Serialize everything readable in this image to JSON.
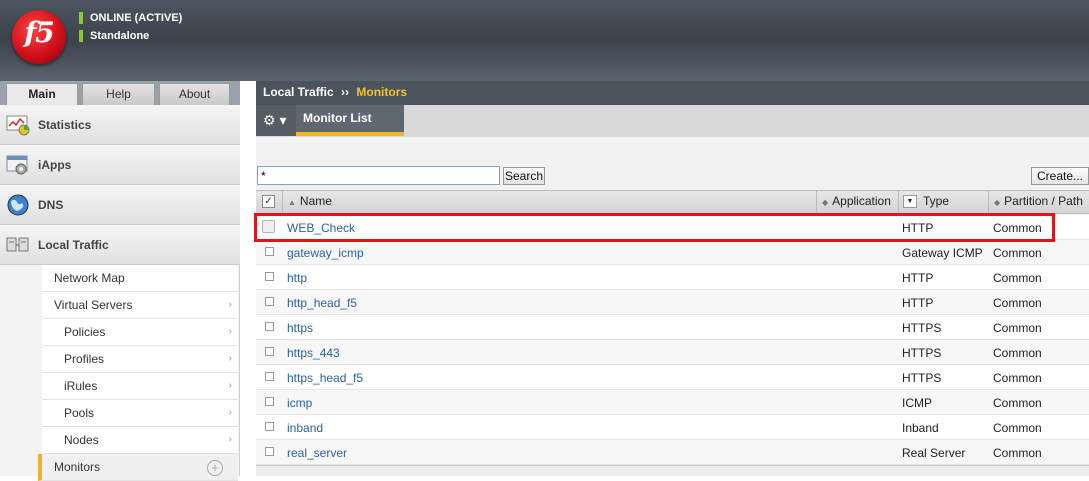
{
  "header": {
    "logo_text": "f5",
    "status_line1": "ONLINE (ACTIVE)",
    "status_line2": "Standalone",
    "status_color": "#8bc53f"
  },
  "tabs": [
    {
      "label": "Main",
      "active": true
    },
    {
      "label": "Help",
      "active": false
    },
    {
      "label": "About",
      "active": false
    }
  ],
  "nav": {
    "sections": [
      {
        "label": "Statistics",
        "icon": "statistics-chart-icon"
      },
      {
        "label": "iApps",
        "icon": "iapps-gear-icon"
      },
      {
        "label": "DNS",
        "icon": "globe-icon"
      },
      {
        "label": "Local Traffic",
        "icon": "local-traffic-icon"
      }
    ],
    "sub_items": [
      {
        "label": "Network Map",
        "indent": 0,
        "chevron": false
      },
      {
        "label": "Virtual Servers",
        "indent": 0,
        "chevron": true
      },
      {
        "label": "Policies",
        "indent": 1,
        "chevron": true
      },
      {
        "label": "Profiles",
        "indent": 1,
        "chevron": true
      },
      {
        "label": "iRules",
        "indent": 1,
        "chevron": true
      },
      {
        "label": "Pools",
        "indent": 1,
        "chevron": true
      },
      {
        "label": "Nodes",
        "indent": 1,
        "chevron": true
      },
      {
        "label": "Monitors",
        "indent": 0,
        "chevron": false,
        "active": true
      }
    ]
  },
  "breadcrumb": {
    "parent": "Local Traffic",
    "separator": "››",
    "current": "Monitors"
  },
  "toolbar": {
    "gear_label": "⚙ ▾",
    "active_tab": "Monitor List"
  },
  "search": {
    "value": "*",
    "button_label": "Search"
  },
  "create_button": "Create...",
  "table": {
    "columns": {
      "name": "Name",
      "application": "Application",
      "type": "Type",
      "partition": "Partition / Path"
    },
    "rows": [
      {
        "name": "WEB_Check",
        "type": "HTTP",
        "partition": "Common",
        "highlighted": true
      },
      {
        "name": "gateway_icmp",
        "type": "Gateway ICMP",
        "partition": "Common"
      },
      {
        "name": "http",
        "type": "HTTP",
        "partition": "Common"
      },
      {
        "name": "http_head_f5",
        "type": "HTTP",
        "partition": "Common"
      },
      {
        "name": "https",
        "type": "HTTPS",
        "partition": "Common"
      },
      {
        "name": "https_443",
        "type": "HTTPS",
        "partition": "Common"
      },
      {
        "name": "https_head_f5",
        "type": "HTTPS",
        "partition": "Common"
      },
      {
        "name": "icmp",
        "type": "ICMP",
        "partition": "Common"
      },
      {
        "name": "inband",
        "type": "Inband",
        "partition": "Common"
      },
      {
        "name": "real_server",
        "type": "Real Server",
        "partition": "Common"
      }
    ]
  },
  "colors": {
    "accent": "#f1b825",
    "link": "#2b5fa8",
    "highlight_box": "#e0141b"
  }
}
